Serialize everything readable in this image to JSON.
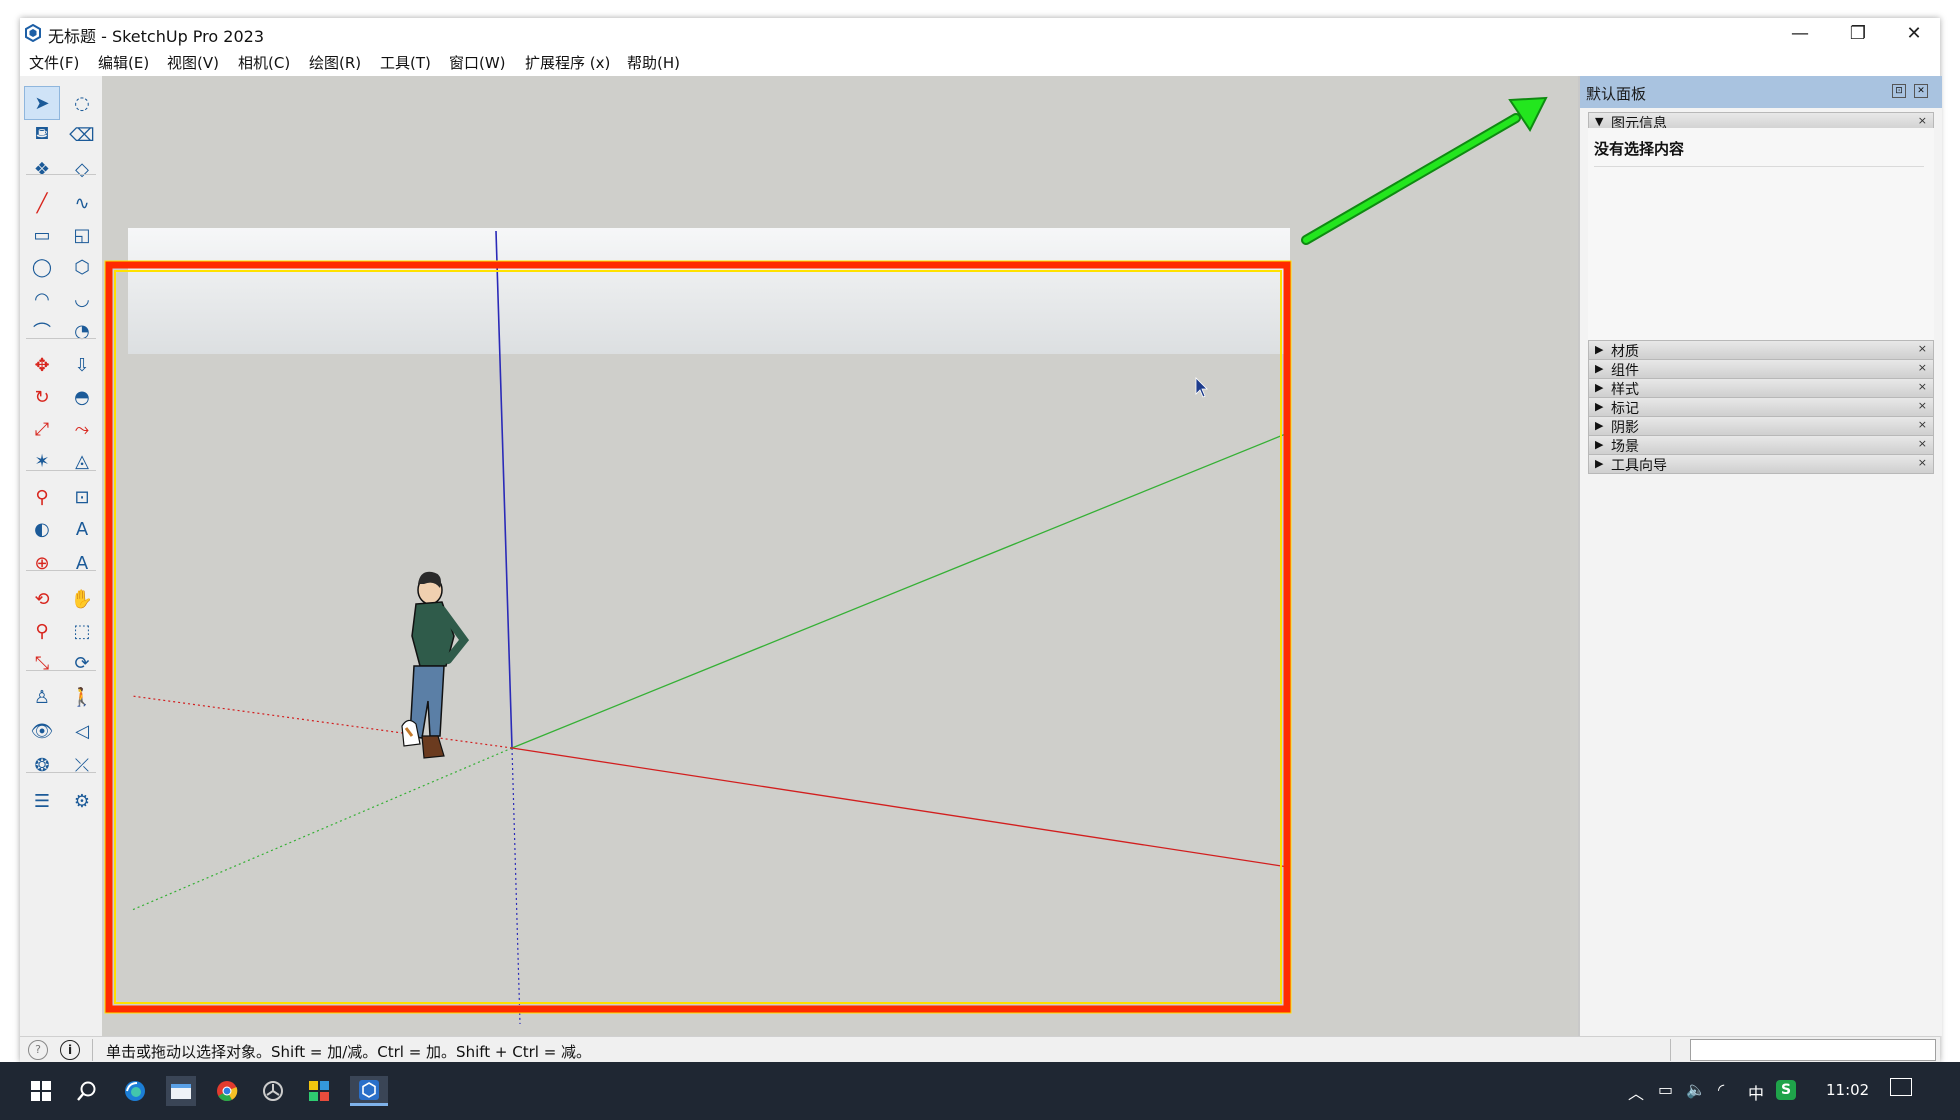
{
  "window": {
    "title": "无标题 - SketchUp Pro 2023",
    "minimize_glyph": "—",
    "maximize_glyph": "❐",
    "close_glyph": "✕"
  },
  "menu": [
    "文件(F)",
    "编辑(E)",
    "视图(V)",
    "相机(C)",
    "绘图(R)",
    "工具(T)",
    "窗口(W)",
    "扩展程序 (x)",
    "帮助(H)"
  ],
  "tools": [
    "select-icon",
    "lasso-select-icon",
    "paint-bucket-icon",
    "eraser-icon",
    "component-icon",
    "tag-icon",
    "line-icon",
    "freehand-icon",
    "rectangle-icon",
    "rotated-rectangle-icon",
    "circle-icon",
    "polygon-icon",
    "arc-icon",
    "two-point-arc-icon",
    "three-point-arc-icon",
    "pie-icon",
    "move-icon",
    "push-pull-icon",
    "rotate-icon",
    "follow-me-icon",
    "scale-icon",
    "offset-icon",
    "axes-icon",
    "section-plane-icon",
    "tape-measure-icon",
    "dimension-icon",
    "protractor-icon",
    "text-icon",
    "position-camera-icon",
    "3d-text-icon",
    "orbit-icon",
    "pan-icon",
    "zoom-icon",
    "zoom-window-icon",
    "zoom-extents-icon",
    "previous-view-icon",
    "walk-icon",
    "walk-person-icon",
    "look-around-icon",
    "sandbox-icon",
    "warehouse-icon",
    "extension-icon",
    "layers-icon",
    "settings-icon"
  ],
  "tray": {
    "title": "默认面板",
    "entity_info_label": "图元信息",
    "entity_info_text": "没有选择内容",
    "panels": [
      "材质",
      "组件",
      "样式",
      "标记",
      "阴影",
      "场景",
      "工具向导"
    ],
    "expanded_glyph": "▼",
    "collapsed_glyph": "▶",
    "close_glyph": "×"
  },
  "status": {
    "text": "单击或拖动以选择对象。Shift = 加/减。Ctrl = 加。Shift + Ctrl = 减。"
  },
  "taskbar": {
    "icons": [
      "windows-start-icon",
      "search-icon",
      "edge-browser-icon",
      "file-explorer-icon",
      "chrome-icon",
      "unity-icon",
      "app-grid-icon",
      "sketchup-icon"
    ],
    "ime": "中",
    "time": "11:02"
  },
  "colors": {
    "highlight_frame": "#ff2a00",
    "highlight_inner": "#ffe100",
    "arrow": "#23e61e",
    "axis_red": "#d21e1e",
    "axis_green": "#35b035",
    "axis_blue": "#2a2ab8",
    "viewport_bg": "#cfcfcb",
    "tray_header": "#a9c3e0"
  }
}
